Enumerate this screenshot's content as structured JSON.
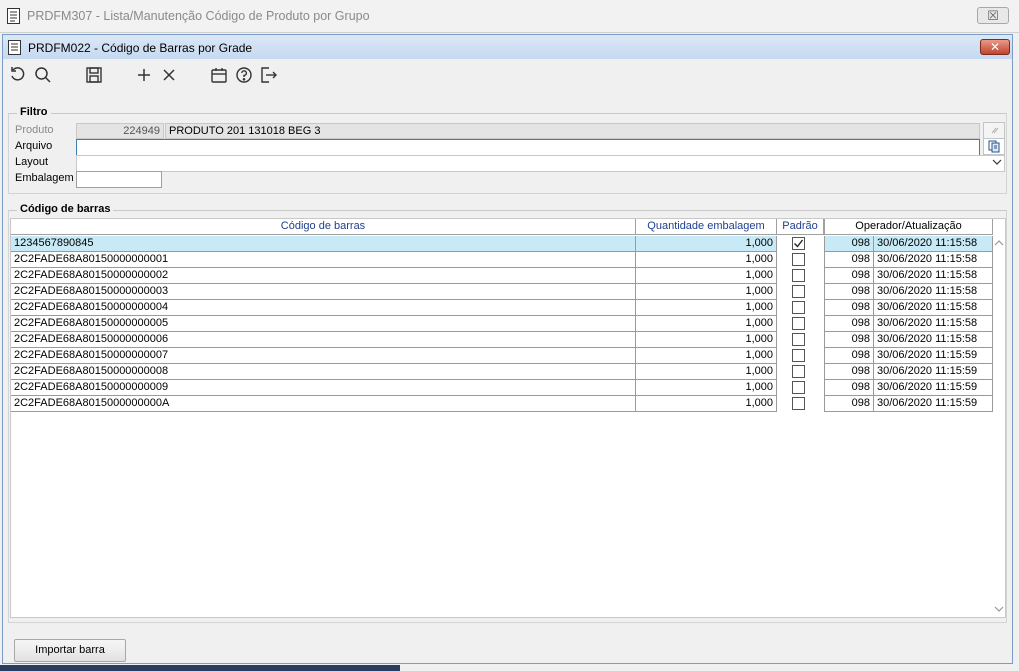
{
  "outer_window": {
    "title": "PRDFM307 - Lista/Manutenção Código de Produto por Grupo",
    "close_glyph": "☒"
  },
  "window": {
    "title": "PRDFM022 - Código de Barras por Grade",
    "close_glyph": "✕"
  },
  "toolbar": [
    {
      "name": "refresh-icon"
    },
    {
      "name": "search-icon"
    },
    {
      "name": "save-icon"
    },
    {
      "name": "add-icon"
    },
    {
      "name": "delete-icon"
    },
    {
      "name": "calendar-icon"
    },
    {
      "name": "help-icon"
    },
    {
      "name": "exit-icon"
    }
  ],
  "filter": {
    "title": "Filtro",
    "produto_label": "Produto",
    "produto_code": "224949",
    "produto_desc": "PRODUTO 201 131018 BEG 3",
    "arquivo_label": "Arquivo",
    "arquivo_value": "",
    "layout_label": "Layout",
    "layout_value": "",
    "embalagem_label": "Embalagem",
    "embalagem_value": ""
  },
  "barcodes": {
    "title": "Código de barras",
    "columns": [
      "Código de barras",
      "Quantidade embalagem",
      "Padrão",
      "Operador/Atualização"
    ],
    "rows": [
      {
        "code": "1234567890845",
        "qty": "1,000",
        "default": true,
        "operator": "098",
        "updated": "30/06/2020 11:15:58"
      },
      {
        "code": "2C2FADE68A80150000000001",
        "qty": "1,000",
        "default": false,
        "operator": "098",
        "updated": "30/06/2020 11:15:58"
      },
      {
        "code": "2C2FADE68A80150000000002",
        "qty": "1,000",
        "default": false,
        "operator": "098",
        "updated": "30/06/2020 11:15:58"
      },
      {
        "code": "2C2FADE68A80150000000003",
        "qty": "1,000",
        "default": false,
        "operator": "098",
        "updated": "30/06/2020 11:15:58"
      },
      {
        "code": "2C2FADE68A80150000000004",
        "qty": "1,000",
        "default": false,
        "operator": "098",
        "updated": "30/06/2020 11:15:58"
      },
      {
        "code": "2C2FADE68A80150000000005",
        "qty": "1,000",
        "default": false,
        "operator": "098",
        "updated": "30/06/2020 11:15:58"
      },
      {
        "code": "2C2FADE68A80150000000006",
        "qty": "1,000",
        "default": false,
        "operator": "098",
        "updated": "30/06/2020 11:15:58"
      },
      {
        "code": "2C2FADE68A80150000000007",
        "qty": "1,000",
        "default": false,
        "operator": "098",
        "updated": "30/06/2020 11:15:59"
      },
      {
        "code": "2C2FADE68A80150000000008",
        "qty": "1,000",
        "default": false,
        "operator": "098",
        "updated": "30/06/2020 11:15:59"
      },
      {
        "code": "2C2FADE68A80150000000009",
        "qty": "1,000",
        "default": false,
        "operator": "098",
        "updated": "30/06/2020 11:15:59"
      },
      {
        "code": "2C2FADE68A8015000000000A",
        "qty": "1,000",
        "default": false,
        "operator": "098",
        "updated": "30/06/2020 11:15:59"
      }
    ]
  },
  "footer": {
    "import_label": "Importar barra"
  },
  "colors": {
    "selected_row": "#c8eaf6",
    "header_text": "#1f3f8f",
    "focus_border": "#3c7fb1",
    "title_close_red": "#c0452d"
  }
}
